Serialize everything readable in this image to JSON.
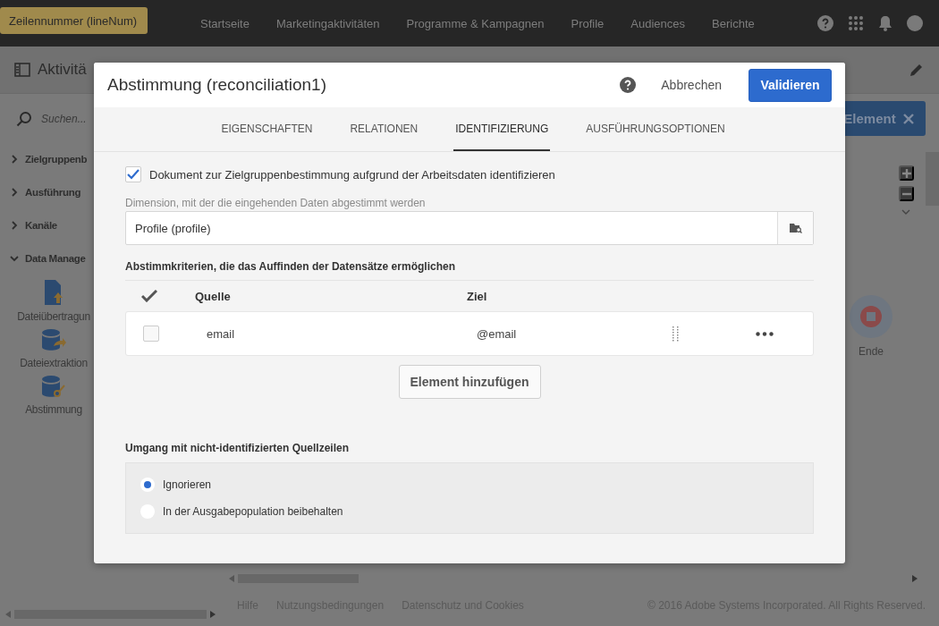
{
  "tooltip": {
    "text": "Zeilennummer (lineNum)"
  },
  "top_nav": {
    "items": [
      "Startseite",
      "Marketingaktivitäten",
      "Programme & Kampagnen",
      "Profile",
      "Audiences",
      "Berichte"
    ]
  },
  "page_header": {
    "title": "Aktivitä"
  },
  "sidebar": {
    "search_placeholder": "Suchen...",
    "groups": [
      {
        "label": "Zielgruppenb",
        "expanded": false
      },
      {
        "label": "Ausführung",
        "expanded": false
      },
      {
        "label": "Kanäle",
        "expanded": false
      },
      {
        "label": "Data Manage",
        "expanded": true,
        "children": [
          {
            "label": "Dateiübertragun",
            "kind": "upload"
          },
          {
            "label": "Dateiextraktion",
            "kind": "extract"
          },
          {
            "label": "Abstimmung",
            "kind": "reconcile"
          }
        ]
      }
    ]
  },
  "canvas": {
    "element_button": "Element",
    "nodes": [
      {
        "label": "Ende",
        "kind": "end"
      }
    ]
  },
  "footer": {
    "links": [
      "Hilfe",
      "Nutzungsbedingungen",
      "Datenschutz und Cookies"
    ],
    "copyright": "© 2016 Adobe Systems Incorporated. All Rights Reserved."
  },
  "dialog": {
    "title": "Abstimmung (reconciliation1)",
    "cancel": "Abbrechen",
    "confirm": "Validieren",
    "tabs": [
      {
        "label": "EIGENSCHAFTEN",
        "selected": false
      },
      {
        "label": "RELATIONEN",
        "selected": false
      },
      {
        "label": "IDENTIFIZIERUNG",
        "selected": true
      },
      {
        "label": "AUSFÜHRUNGSOPTIONEN",
        "selected": false
      }
    ],
    "identify": {
      "label": "Dokument zur Zielgruppenbestimmung aufgrund der Arbeitsdaten identifizieren",
      "checked": true
    },
    "dimension": {
      "label": "Dimension, mit der die eingehenden Daten abgestimmt werden",
      "value": "Profile (profile)"
    },
    "criteria": {
      "title": "Abstimmkriterien, die das Auffinden der Datensätze ermöglichen",
      "columns": [
        "Quelle",
        "Ziel"
      ],
      "rows": [
        {
          "source": "email",
          "target": "@email",
          "checked": false
        }
      ],
      "add_button": "Element hinzufügen"
    },
    "unidentified": {
      "title": "Umgang mit nicht-identifizierten Quellzeilen",
      "options": [
        {
          "label": "Ignorieren",
          "selected": true
        },
        {
          "label": "In der Ausgabepopulation beibehalten",
          "selected": false
        }
      ]
    }
  }
}
